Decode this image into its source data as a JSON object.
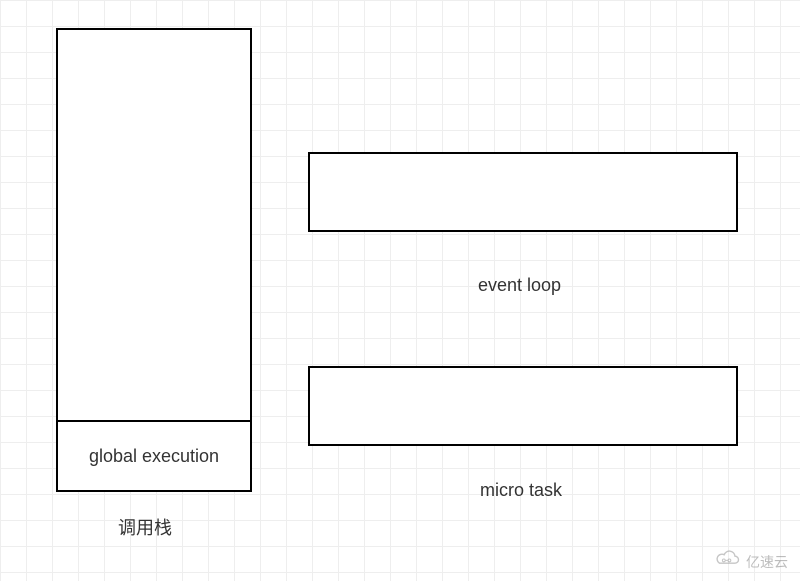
{
  "callstack": {
    "innerLabel": "global execution",
    "caption": "调用栈"
  },
  "eventLoop": {
    "caption": "event loop"
  },
  "microTask": {
    "caption": "micro task"
  },
  "watermark": {
    "text": "亿速云"
  }
}
